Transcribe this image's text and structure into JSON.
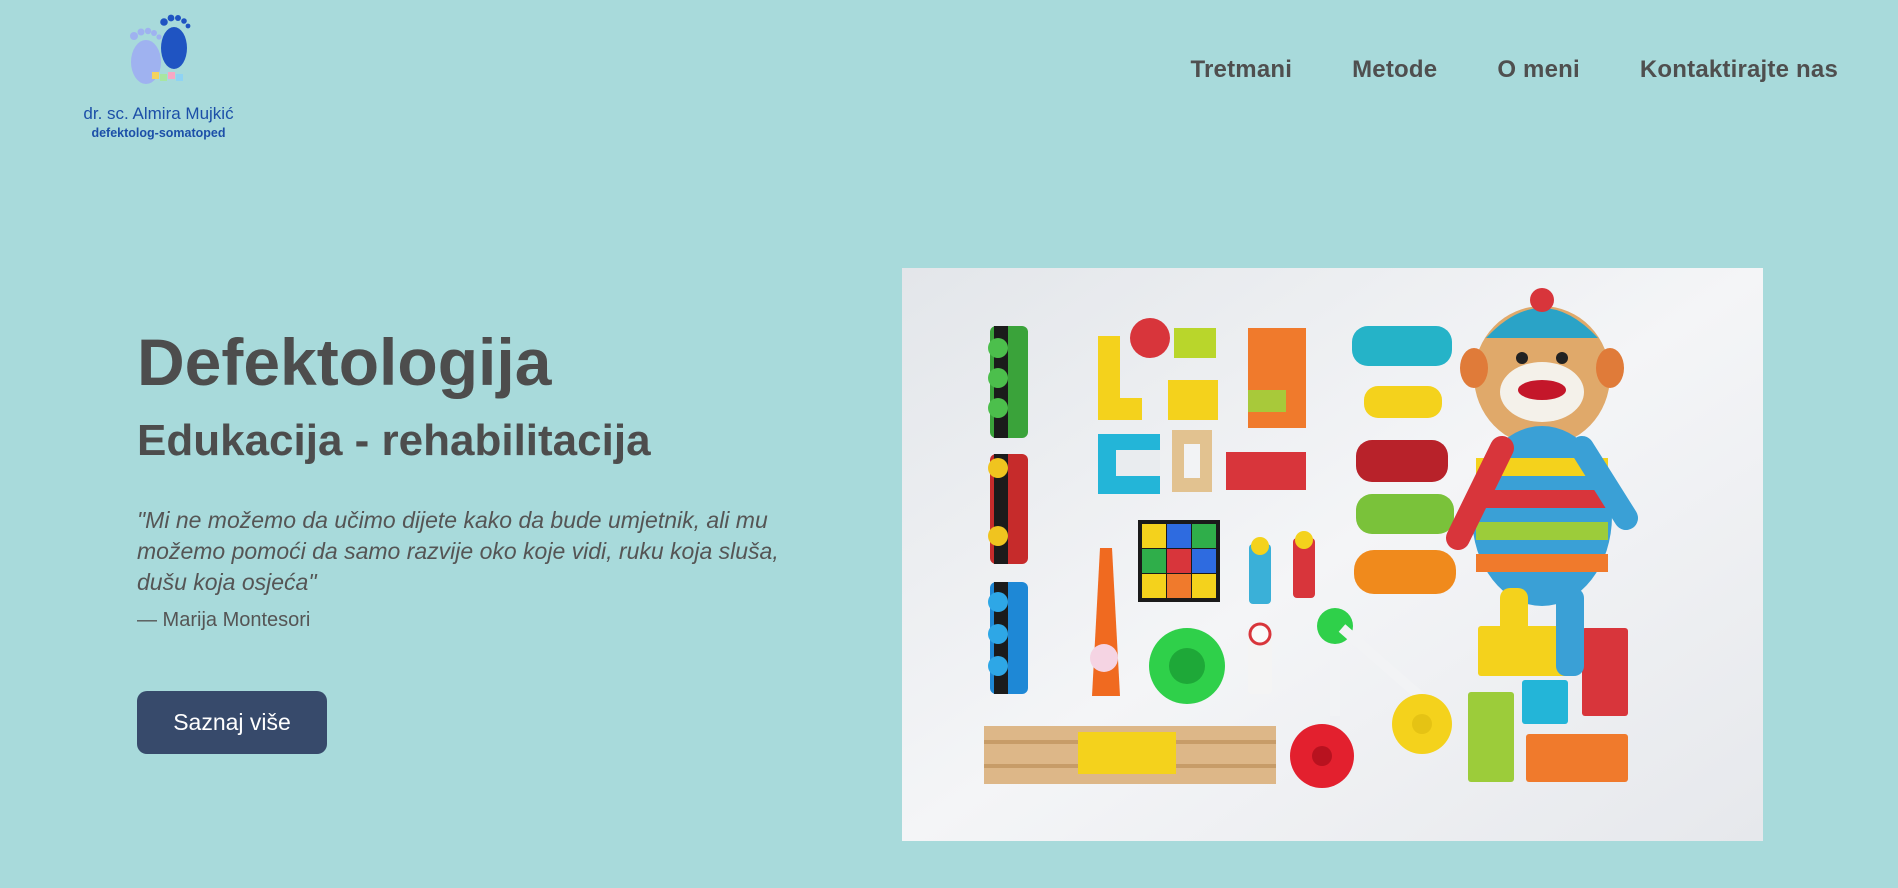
{
  "header": {
    "logo": {
      "name": "dr. sc. Almira Mujkić",
      "subtitle": "defektolog-somatoped",
      "icon": "baby-feet-logo"
    },
    "nav": [
      {
        "label": "Tretmani"
      },
      {
        "label": "Metode"
      },
      {
        "label": "O meni"
      },
      {
        "label": "Kontaktirajte nas"
      }
    ]
  },
  "hero": {
    "title": "Defektologija",
    "subtitle": "Edukacija - rehabilitacija",
    "quote": "\"Mi ne možemo da učimo dijete kako da bude umjetnik, ali mu možemo pomoći da samo razvije oko koje vidi, ruku koja sluša, dušu koja osjeća\"",
    "author": "— Marija Montesori",
    "cta_label": "Saznaj više"
  },
  "image": {
    "description_icon": "toys-photo"
  },
  "colors": {
    "background": "#a8dadb",
    "text": "#4d4d4d",
    "button": "#374a6b",
    "logo_blue": "#1c4fa8"
  }
}
